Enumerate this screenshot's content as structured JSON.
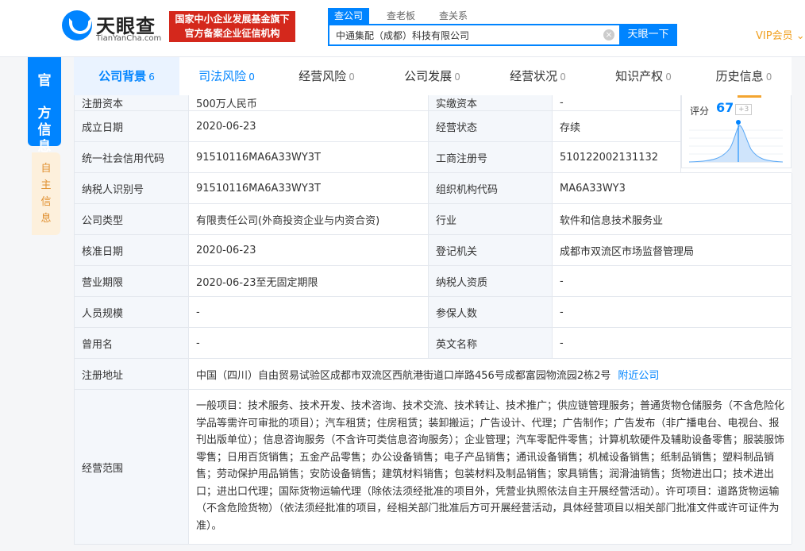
{
  "header": {
    "logo_title": "天眼查",
    "logo_domain": "TianYanCha.com",
    "badge_line1": "国家中小企业发展基金旗下",
    "badge_line2": "官方备案企业征信机构",
    "search_tabs": [
      "查公司",
      "查老板",
      "查关系"
    ],
    "search_value": "中通集配（成都）科技有限公司",
    "search_button": "天眼一下",
    "vip": "VIP会员"
  },
  "side": {
    "active": [
      "官",
      "方",
      "信",
      "息"
    ],
    "inactive": [
      "自",
      "主",
      "信",
      "息"
    ]
  },
  "tabs": [
    {
      "label": "公司背景",
      "count": "6"
    },
    {
      "label": "司法风险",
      "count": "0"
    },
    {
      "label": "经营风险",
      "count": "0"
    },
    {
      "label": "公司发展",
      "count": "0"
    },
    {
      "label": "经营状况",
      "count": "0"
    },
    {
      "label": "知识产权",
      "count": "0"
    },
    {
      "label": "历史信息",
      "count": "0"
    }
  ],
  "score": {
    "label": "评分",
    "value": "67",
    "delta": "+3"
  },
  "rows": [
    {
      "l1": "注册资本",
      "v1": "500万人民币",
      "l2": "实缴资本",
      "v2": "-"
    },
    {
      "l1": "成立日期",
      "v1": "2020-06-23",
      "l2": "经营状态",
      "v2": "存续"
    },
    {
      "l1": "统一社会信用代码",
      "v1": "91510116MA6A33WY3T",
      "l2": "工商注册号",
      "v2": "510122002131132"
    },
    {
      "l1": "纳税人识别号",
      "v1": "91510116MA6A33WY3T",
      "l2": "组织机构代码",
      "v2": "MA6A33WY3"
    },
    {
      "l1": "公司类型",
      "v1": "有限责任公司(外商投资企业与内资合资)",
      "l2": "行业",
      "v2": "软件和信息技术服务业"
    },
    {
      "l1": "核准日期",
      "v1": "2020-06-23",
      "l2": "登记机关",
      "v2": "成都市双流区市场监督管理局"
    },
    {
      "l1": "营业期限",
      "v1": "2020-06-23至无固定期限",
      "l2": "纳税人资质",
      "v2": "-"
    },
    {
      "l1": "人员规模",
      "v1": "-",
      "l2": "参保人数",
      "v2": "-"
    },
    {
      "l1": "曾用名",
      "v1": "-",
      "l2": "英文名称",
      "v2": "-"
    }
  ],
  "address": {
    "label": "注册地址",
    "value": "中国（四川）自由贸易试验区成都市双流区西航港街道口岸路456号成都富园物流园2栋2号",
    "link": "附近公司"
  },
  "scope": {
    "label": "经营范围",
    "value": "一般项目：技术服务、技术开发、技术咨询、技术交流、技术转让、技术推广；供应链管理服务；普通货物仓储服务（不含危险化学品等需许可审批的项目）；汽车租赁；住房租赁；装卸搬运；广告设计、代理；广告制作；广告发布（非广播电台、电视台、报刊出版单位）；信息咨询服务（不含许可类信息咨询服务）；企业管理；汽车零配件零售；计算机软硬件及辅助设备零售；服装服饰零售；日用百货销售；五金产品零售；办公设备销售；电子产品销售；通讯设备销售；机械设备销售；纸制品销售；塑料制品销售；劳动保护用品销售；安防设备销售；建筑材料销售；包装材料及制品销售；家具销售；润滑油销售；货物进出口；技术进出口；进出口代理；国际货物运输代理（除依法须经批准的项目外，凭营业执照依法自主开展经营活动）。许可项目：道路货物运输（不含危险货物）（依法须经批准的项目，经相关部门批准后方可开展经营活动，具体经营项目以相关部门批准文件或许可证件为准）。"
  },
  "colors": {
    "brand": "#0084ff",
    "badge": "#d4281c",
    "vip": "#f0a020"
  }
}
